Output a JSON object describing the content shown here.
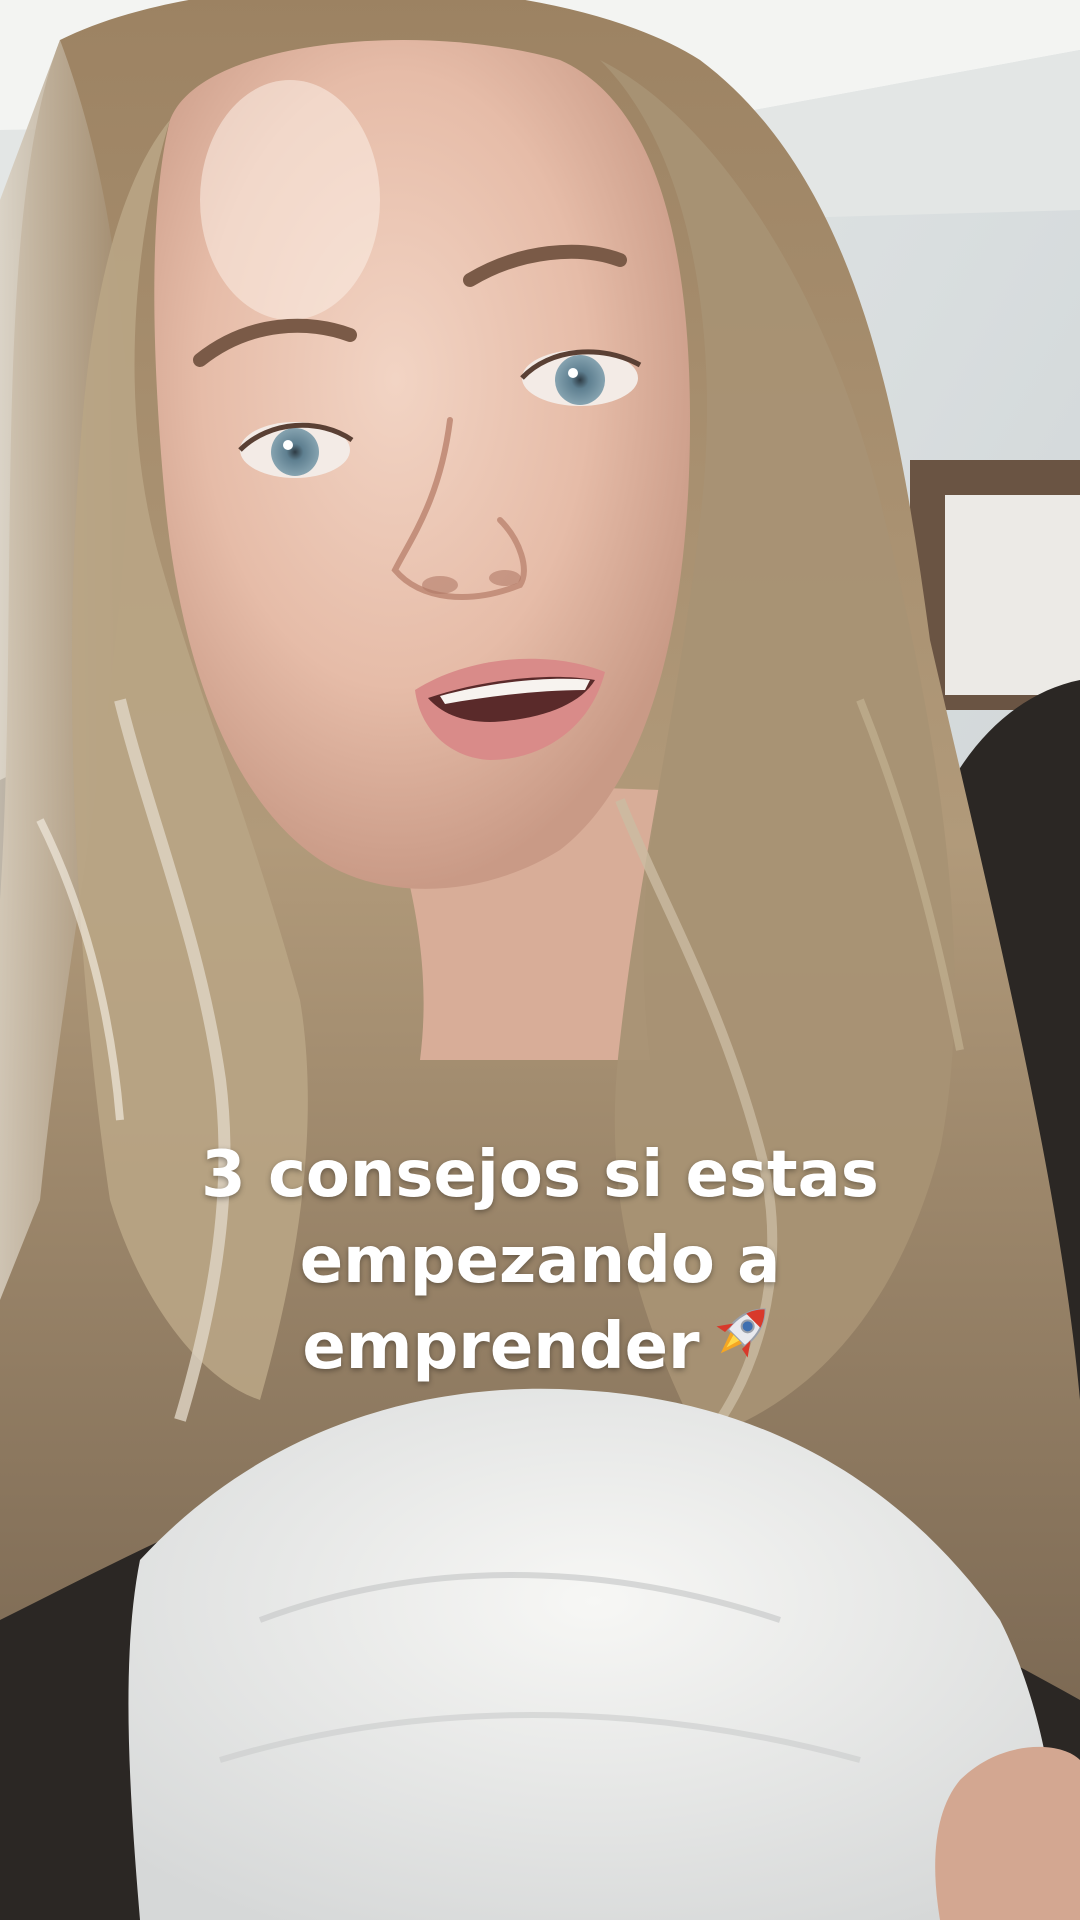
{
  "caption": {
    "line1": "3 consejos si estas",
    "line2": "empezando a",
    "line3": "emprender",
    "emoji_icon": "rocket-icon"
  },
  "scene": {
    "subject": "selfie-video-frame",
    "colors": {
      "wall": "#d9dedf",
      "ceiling": "#eef0ef",
      "hair": "#a8906f",
      "skin": "#e8c1ae",
      "shirt": "#eeeeec",
      "dark_jacket": "#2b2724",
      "eyes": "#6f8d9c",
      "lips": "#d98b89",
      "frame": "#6a5443"
    }
  }
}
